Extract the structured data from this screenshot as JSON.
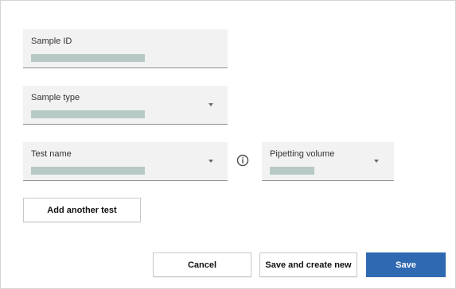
{
  "form": {
    "sample_id": {
      "label": "Sample ID"
    },
    "sample_type": {
      "label": "Sample type"
    },
    "test_name": {
      "label": "Test name"
    },
    "pipetting_volume": {
      "label": "Pipetting volume"
    },
    "add_another_test": {
      "label": "Add another test"
    }
  },
  "footer": {
    "cancel": "Cancel",
    "save_and_create_new": "Save and create new",
    "save": "Save"
  },
  "colors": {
    "field_background": "#f2f2f2",
    "placeholder_bar": "#b7c9c7",
    "primary_button": "#2f69b2"
  },
  "icons": {
    "dropdown": "chevron-down-icon",
    "info": "info-icon"
  }
}
